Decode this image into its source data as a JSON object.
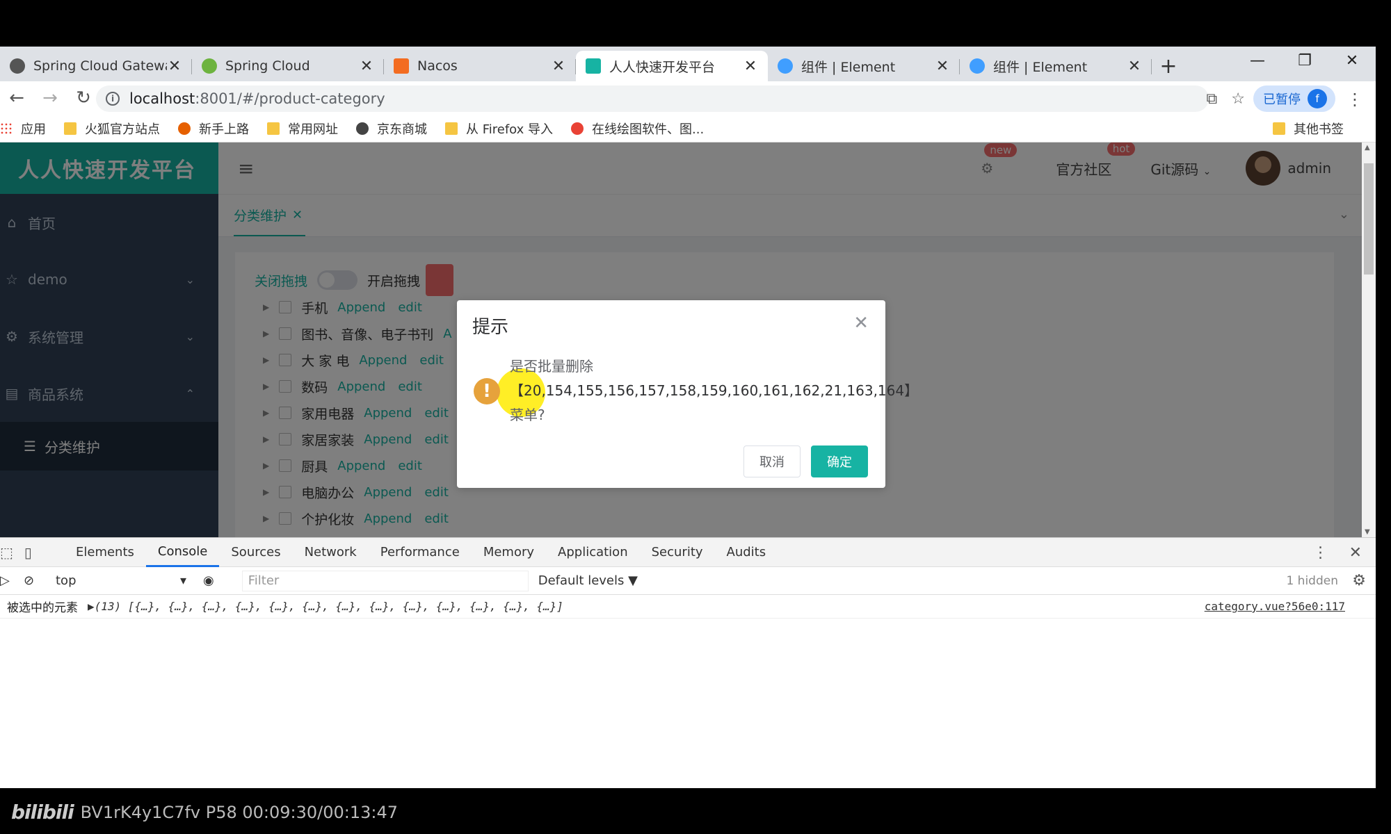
{
  "browser": {
    "tabs": [
      {
        "title": "Spring Cloud Gateway",
        "favicon_color": "#555555",
        "active": false
      },
      {
        "title": "Spring Cloud",
        "favicon_color": "#6db33f",
        "active": false
      },
      {
        "title": "Nacos",
        "favicon_color": "#f36c21",
        "active": false
      },
      {
        "title": "人人快速开发平台",
        "favicon_color": "#17b3a3",
        "active": true
      },
      {
        "title": "组件 | Element",
        "favicon_color": "#409eff",
        "active": false
      },
      {
        "title": "组件 | Element",
        "favicon_color": "#409eff",
        "active": false
      }
    ],
    "address": {
      "host": "localhost",
      "path": ":8001/#/product-category"
    },
    "profile": {
      "label": "已暂停",
      "initial": "f"
    },
    "bookmarks": [
      "应用",
      "火狐官方站点",
      "新手上路",
      "常用网址",
      "京东商城",
      "从 Firefox 导入",
      "在线绘图软件、图..."
    ],
    "other_bookmarks": "其他书签"
  },
  "app": {
    "brand": "人人快速开发平台",
    "menu": [
      {
        "label": "首页",
        "icon": "home-icon"
      },
      {
        "label": "demo",
        "icon": "star-icon"
      },
      {
        "label": "系统管理",
        "icon": "gear-icon"
      },
      {
        "label": "商品系统",
        "icon": "list-icon"
      }
    ],
    "submenu": "分类维护",
    "header": {
      "link1": "官方社区",
      "badge_new": "new",
      "badge_hot": "hot",
      "git": "Git源码",
      "user": "admin"
    },
    "page_tab": "分类维护",
    "controls": {
      "off_label": "关闭拖拽",
      "on_label": "开启拖拽"
    },
    "tree": [
      {
        "label": "手机",
        "append": "Append",
        "edit": "edit"
      },
      {
        "label": "图书、音像、电子书刊",
        "append": "A",
        "edit": ""
      },
      {
        "label": "大 家 电",
        "append": "Append",
        "edit": "edit"
      },
      {
        "label": "数码",
        "append": "Append",
        "edit": "edit"
      },
      {
        "label": "家用电器",
        "append": "Append",
        "edit": "edit"
      },
      {
        "label": "家居家装",
        "append": "Append",
        "edit": "edit"
      },
      {
        "label": "厨具",
        "append": "Append",
        "edit": "edit"
      },
      {
        "label": "电脑办公",
        "append": "Append",
        "edit": "edit"
      },
      {
        "label": "个护化妆",
        "append": "Append",
        "edit": "edit"
      }
    ]
  },
  "dialog": {
    "title": "提示",
    "line1": "是否批量删除",
    "line2": "【20,154,155,156,157,158,159,160,161,162,21,163,164】",
    "line3": "菜单?",
    "cancel": "取消",
    "ok": "确定"
  },
  "devtools": {
    "tabs": [
      "Elements",
      "Console",
      "Sources",
      "Network",
      "Performance",
      "Memory",
      "Application",
      "Security",
      "Audits"
    ],
    "active_tab": "Console",
    "context": "top",
    "filter_placeholder": "Filter",
    "levels": "Default levels ▼",
    "hidden": "1 hidden",
    "log_label": "被选中的元素",
    "log_value": "▶(13) [{…}, {…}, {…}, {…}, {…}, {…}, {…}, {…}, {…}, {…}, {…}, {…}, {…}]",
    "log_source": "category.vue?56e0:117"
  },
  "video_watermark": "BV1rK4y1C7fv P58 00:09:30/00:13:47"
}
